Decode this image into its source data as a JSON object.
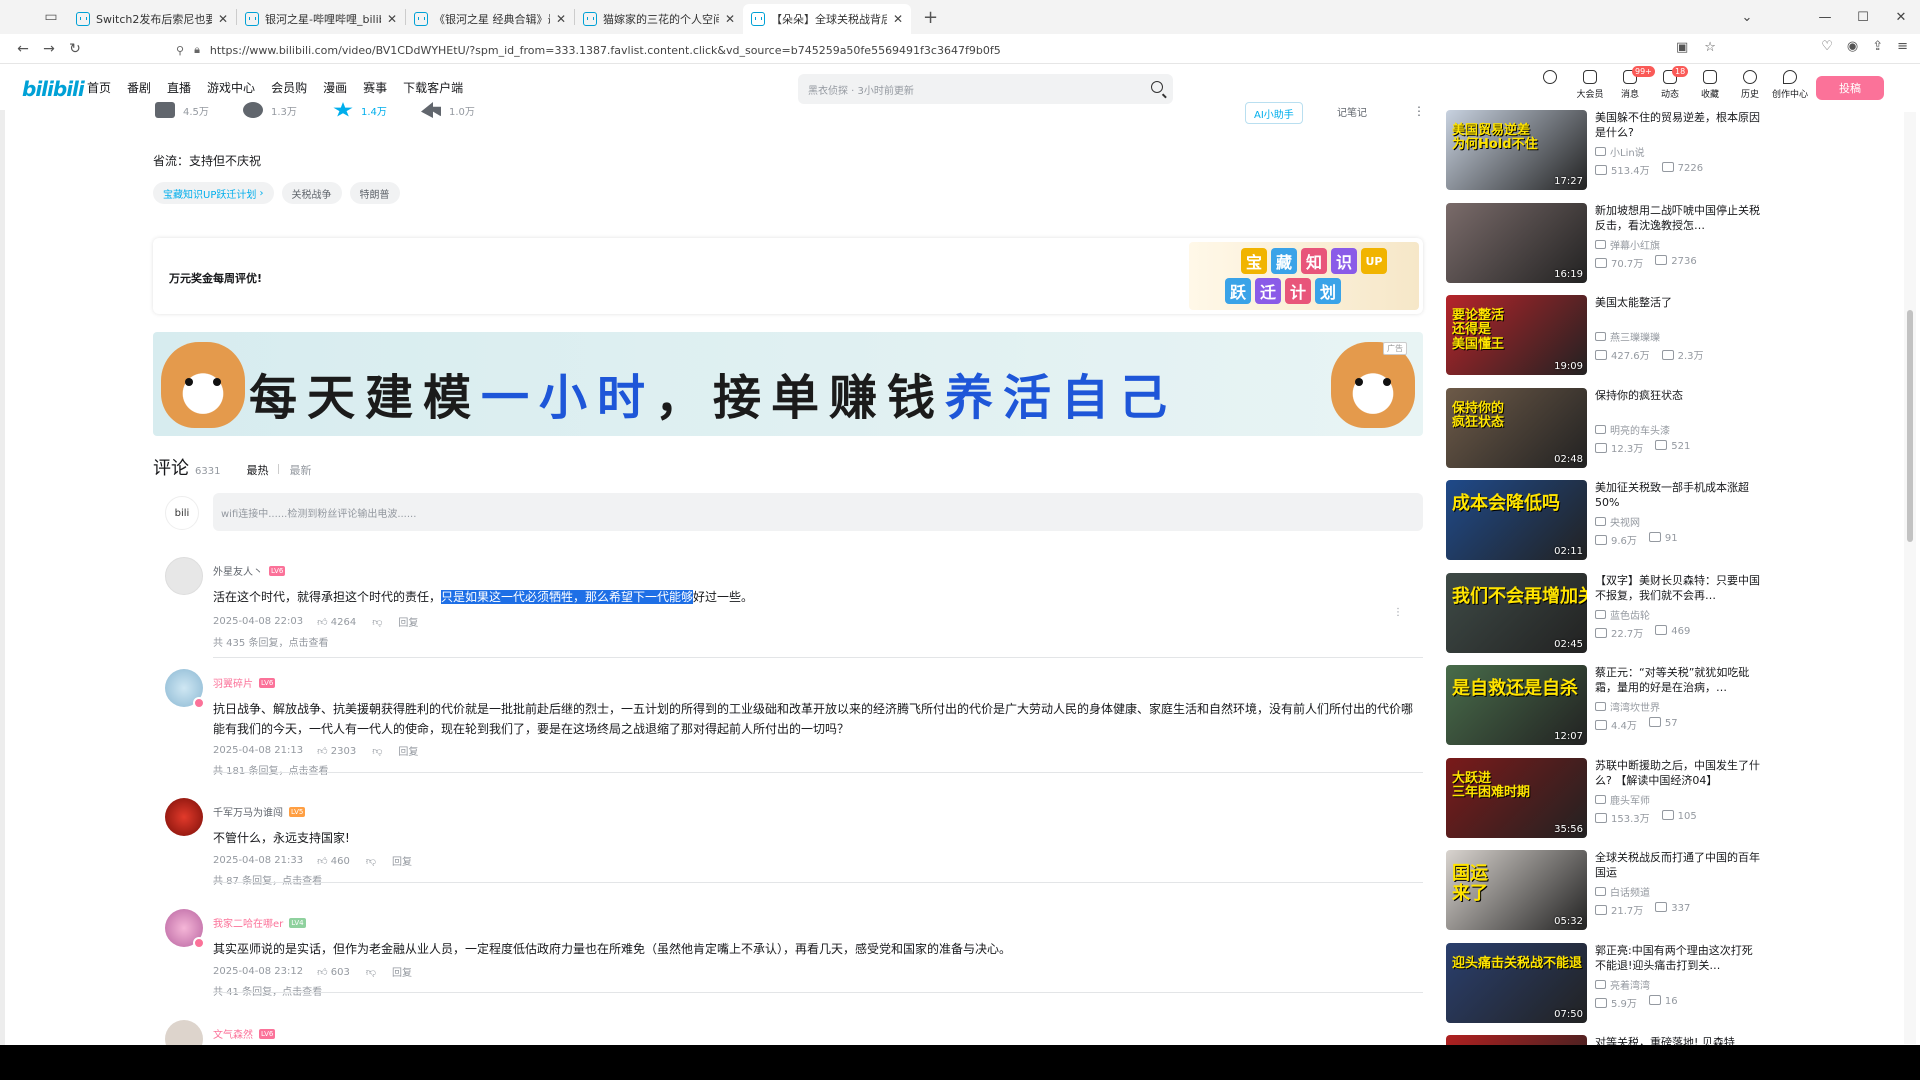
{
  "browser": {
    "tabs": [
      {
        "title": "Switch2发布后索尼也要做好",
        "active": false
      },
      {
        "title": "银河之星-哔哩哔哩_bilibili",
        "active": false
      },
      {
        "title": "《银河之星 经典合辑》最新宣传",
        "active": false
      },
      {
        "title": "猫嫁家的三花的个人空间-猫嫁家",
        "active": false
      },
      {
        "title": "【朵朵】全球关税战背后，关",
        "active": true
      }
    ],
    "url": "https://www.bilibili.com/video/BV1CDdWYHEtU/?spm_id_from=333.1387.favlist.content.click&vd_source=b745259a50fe5569491f3c3647f9b0f5"
  },
  "header": {
    "logo": "bilibili",
    "nav": [
      "首页",
      "番剧",
      "直播",
      "游戏中心",
      "会员购",
      "漫画",
      "赛事",
      "下载客户端"
    ],
    "search_placeholder": "黑衣侦探 · 3小时前更新",
    "icons": [
      {
        "label": "大会员",
        "badge": ""
      },
      {
        "label": "消息",
        "badge": "99+"
      },
      {
        "label": "动态",
        "badge": "18"
      },
      {
        "label": "收藏",
        "badge": ""
      },
      {
        "label": "历史",
        "badge": ""
      },
      {
        "label": "创作中心",
        "badge": ""
      }
    ],
    "upload": "投稿"
  },
  "video": {
    "like": "4.5万",
    "coin": "1.3万",
    "fav": "1.4万",
    "share": "1.0万",
    "ai": "AI小助手",
    "note": "记笔记",
    "desc": "省流：支持但不庆祝",
    "tags": [
      "宝藏知识UP跃迁计划",
      "关税战争",
      "特朗普"
    ],
    "event_title": "万元奖金每周评优!",
    "event_art_row1": [
      "宝",
      "藏",
      "知",
      "识",
      "UP"
    ],
    "event_art_row2": [
      "跃",
      "迁",
      "计",
      "划"
    ],
    "banner_text_1": "每天建模",
    "banner_text_2": "一小时",
    "banner_text_3": "，接单赚钱",
    "banner_text_4": "养活自己",
    "ad_mark": "广告"
  },
  "comments": {
    "title": "评论",
    "count": "6331",
    "sort_hot": "最热",
    "sort_new": "最新",
    "input_placeholder": "wifi连接中......检测到粉丝评论输出电波......",
    "items": [
      {
        "user": "外星友人丶",
        "level": "LV6",
        "text_before": "活在这个时代，就得承担这个时代的责任，",
        "text_selected": "只是如果这一代必须牺牲，那么希望下一代能够",
        "text_after": "好过一些。",
        "time": "2025-04-08 22:03",
        "likes": "4264",
        "reply_label": "回复",
        "sub": "共 435 条回复，点击查看"
      },
      {
        "user": "羽翼碎片",
        "level": "LV6",
        "text": "抗日战争、解放战争、抗美援朝获得胜利的代价就是一批批前赴后继的烈士，一五计划的所得到的工业级础和改革开放以来的经济腾飞所付出的代价是广大劳动人民的身体健康、家庭生活和自然环境，没有前人们所付出的代价哪能有我们的今天，一代人有一代人的使命，现在轮到我们了，要是在这场终局之战退缩了那对得起前人所付出的一切吗？",
        "time": "2025-04-08 21:13",
        "likes": "2303",
        "reply_label": "回复",
        "sub": "共 181 条回复，点击查看"
      },
      {
        "user": "千军万马为谁闯",
        "level": "LV5",
        "text": "不管什么，永远支持国家!",
        "time": "2025-04-08 21:33",
        "likes": "460",
        "reply_label": "回复",
        "sub": "共 87 条回复，点击查看"
      },
      {
        "user": "我家二哈在哪er",
        "level": "LV4",
        "text": "其实巫师说的是实话，但作为老金融从业人员，一定程度低估政府力量也在所难免（虽然他肯定嘴上不承认），再看几天，感受党和国家的准备与决心。",
        "time": "2025-04-08 23:12",
        "likes": "603",
        "reply_label": "回复",
        "sub": "共 41 条回复，点击查看"
      },
      {
        "user": "文气森然",
        "level": "LV6"
      }
    ]
  },
  "recommend": [
    {
      "title": "美国躲不住的贸易逆差，根本原因是什么?",
      "author": "小Lin说",
      "views": "513.4万",
      "danmaku": "7226",
      "duration": "17:27",
      "caption": "美国贸易逆差\n为何Hold不住",
      "bg": "#c8d2e0"
    },
    {
      "title": "新加坡想用二战吓唬中国停止关税反击，看沈逸教授怎…",
      "author": "弹幕小红旗",
      "views": "70.7万",
      "danmaku": "2736",
      "duration": "16:19",
      "caption": "",
      "bg": "#7a6b6a"
    },
    {
      "title": "美国太能整活了",
      "author": "燕三瓅瓅瓅",
      "views": "427.6万",
      "danmaku": "2.3万",
      "duration": "19:09",
      "caption": "要论整活\n还得是\n美国懂王",
      "bg": "#b6242a"
    },
    {
      "title": "保持你的疯狂状态",
      "author": "明亮的车头漆",
      "views": "12.3万",
      "danmaku": "521",
      "duration": "02:48",
      "caption": "保持你的\n疯狂状态",
      "bg": "#6d5a48"
    },
    {
      "title": "美加征关税致一部手机成本涨超50%",
      "author": "央视网",
      "views": "9.6万",
      "danmaku": "91",
      "duration": "02:11",
      "caption": "成本会降低吗",
      "bg": "#1f4a8a"
    },
    {
      "title": "【双字】美财长贝森特：只要中国不报复，我们就不会再…",
      "author": "蓝色齿轮",
      "views": "22.7万",
      "danmaku": "469",
      "duration": "02:45",
      "caption": "我们不会再增加关",
      "bg": "#3e4a46"
    },
    {
      "title": "蔡正元：“对等关税”就犹如吃砒霜，量用的好是在治病，…",
      "author": "湾湾坎世界",
      "views": "4.4万",
      "danmaku": "57",
      "duration": "12:07",
      "caption": "是自救还是自杀",
      "bg": "#486c4a"
    },
    {
      "title": "苏联中断援助之后，中国发生了什么? 【解读中国经济04】",
      "author": "鹿头军师",
      "views": "153.3万",
      "danmaku": "105",
      "duration": "35:56",
      "caption": "大跃进\n三年困难时期",
      "bg": "#7a1a1a"
    },
    {
      "title": "全球关税战反而打通了中国的百年国运",
      "author": "白话频道",
      "views": "21.7万",
      "danmaku": "337",
      "duration": "05:32",
      "caption": "国运\n来了",
      "bg": "#d9d4cf"
    },
    {
      "title": "郭正亮:中国有两个理由这次打死不能退!迎头痛击打到关…",
      "author": "亮着湾湾",
      "views": "5.9万",
      "danmaku": "16",
      "duration": "07:50",
      "caption": "迎头痛击关税战不能退",
      "bg": "#2a3f6e"
    },
    {
      "title": "对等关税，重磅落地!  贝森特",
      "author": "",
      "views": "",
      "danmaku": "",
      "duration": "",
      "caption": "",
      "bg": "#b02020"
    }
  ]
}
